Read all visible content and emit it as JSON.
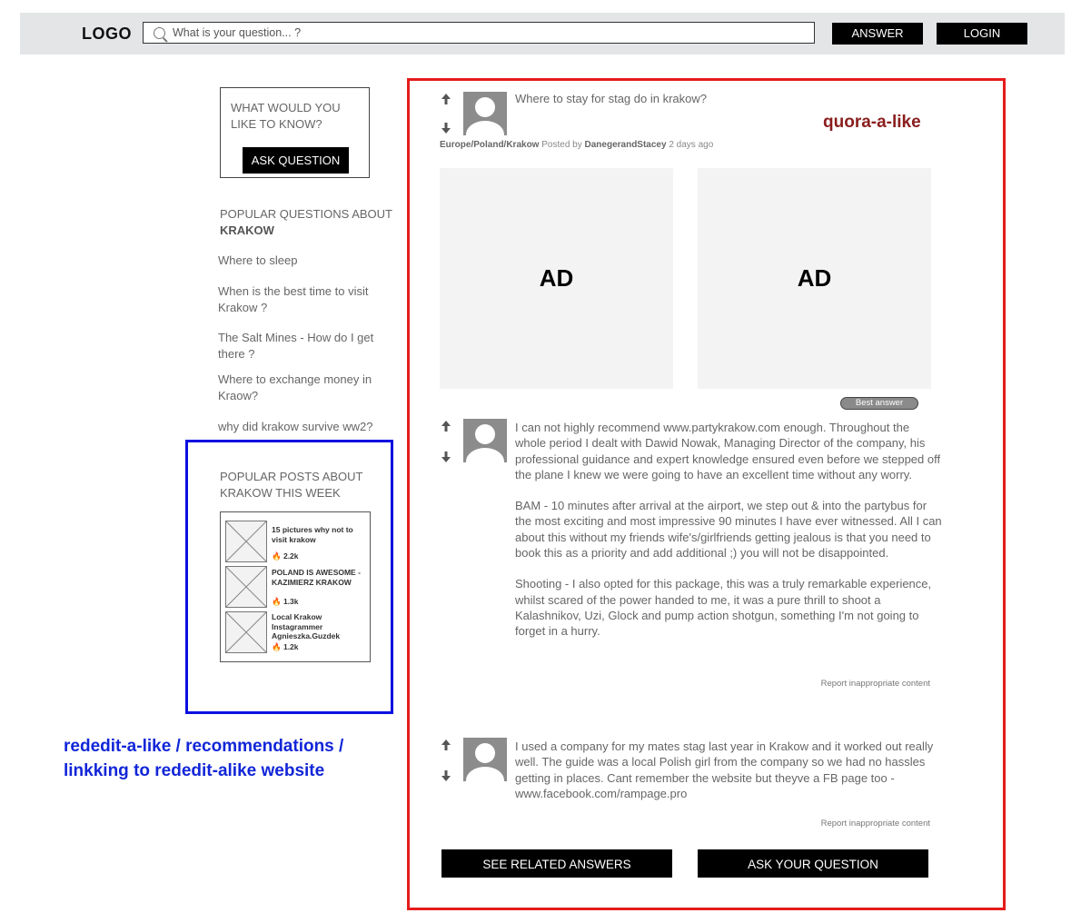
{
  "header": {
    "logo": "LOGO",
    "search_placeholder": "What is your question... ?",
    "answer_label": "ANSWER",
    "login_label": "LOGIN"
  },
  "sidebar": {
    "ask_box": {
      "title": "WHAT WOULD YOU LIKE TO KNOW?",
      "button_label": "ASK QUESTION"
    },
    "popular_questions": {
      "title_prefix": "POPULAR QUESTIONS ABOUT",
      "title_city": "KRAKOW",
      "items": [
        "Where to sleep",
        "When is the best time to visit Krakow ?",
        "The Salt Mines - How do I get there ?",
        "Where to exchange money in Kraow?",
        "why did krakow survive ww2?"
      ]
    },
    "popular_posts": {
      "title": "POPULAR POSTS ABOUT KRAKOW THIS WEEK",
      "items": [
        {
          "title": "15 pictures why not to visit krakow",
          "count": "2.2k"
        },
        {
          "title": "POLAND IS AWESOME - KAZIMIERZ KRAKOW",
          "count": "1.3k"
        },
        {
          "title": "Local Krakow Instagrammer Agnieszka.Guzdek",
          "count": "1.2k"
        }
      ]
    },
    "annotation": "rededit-a-like / recommendations / linkking to rededit-alike website"
  },
  "main": {
    "annotation": "quora-a-like",
    "question": {
      "title": "Where to stay for stag do in krakow?",
      "breadcrumb": "Europe/Poland/Krakow",
      "posted_by_label": "Posted by",
      "author": "DanegerandStacey",
      "time": "2 days ago"
    },
    "ads": [
      "AD",
      "AD"
    ],
    "best_answer_badge": "Best answer",
    "answers": [
      {
        "paragraphs": [
          "I can not highly recommend www.partykrakow.com enough. Throughout the whole period I dealt with Dawid Nowak, Managing Director of the company, his professional guidance and expert knowledge ensured even before we stepped off the plane I knew we were going to have an excellent time without any worry.",
          "BAM - 10 minutes after arrival at the airport, we step out & into the partybus for the most exciting and most impressive 90 minutes I have ever witnessed. All I can about this without my friends wife's/girlfriends getting jealous is that you need to book this as a priority and add additional ;) you will not be disappointed.",
          "Shooting - I also opted for this package, this was a truly remarkable experience, whilst scared of the power handed to me, it was a pure thrill to shoot a Kalashnikov, Uzi, Glock and pump action shotgun, something I'm not going to forget in a hurry."
        ],
        "report": "Report inappropriate content"
      },
      {
        "paragraphs": [
          "I used a company for my mates stag last year in Krakow and it worked out really well. The guide was a local Polish girl from the company so we had no hassles getting in places. Cant remember the website but theyve a FB page too - www.facebook.com/rampage.pro"
        ],
        "report": "Report inappropriate content"
      }
    ],
    "buttons": {
      "related": "SEE RELATED ANSWERS",
      "ask": "ASK YOUR QUESTION"
    }
  },
  "colors": {
    "red_frame": "#e51c1c",
    "blue_frame": "#0b10e0",
    "blue_note": "#1226d8",
    "quora_label": "#8a1e1e",
    "topbar": "#e4e5e7"
  }
}
